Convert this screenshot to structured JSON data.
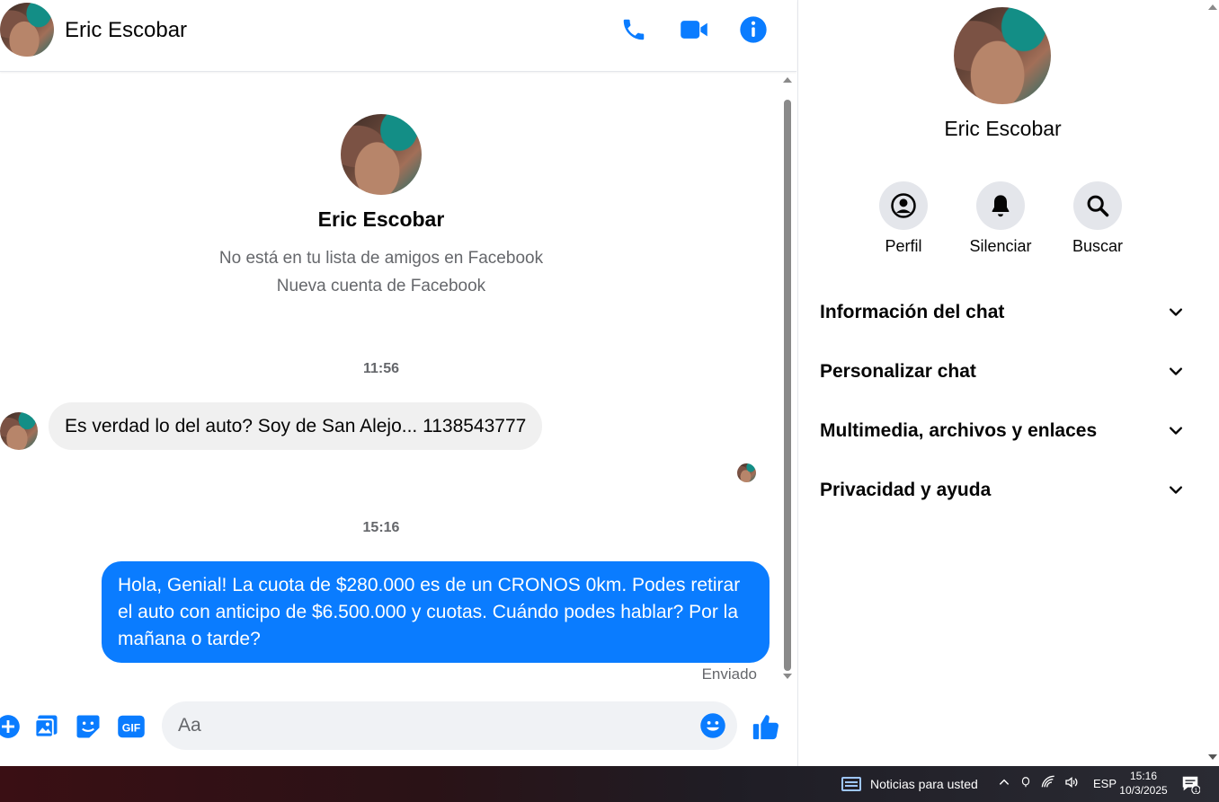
{
  "chat_header": {
    "name": "Eric Escobar",
    "icons": [
      "phone-icon",
      "video-camera-icon",
      "info-icon"
    ]
  },
  "conversation": {
    "profile": {
      "name": "Eric Escobar",
      "line1": "No está en tu lista de amigos en Facebook",
      "line2": "Nueva cuenta de Facebook"
    },
    "messages": [
      {
        "time": "11:56",
        "direction": "incoming",
        "text": "Es verdad lo del auto? Soy de  San Alejo... 1138543777"
      },
      {
        "time": "15:16",
        "direction": "outgoing",
        "text": "Hola, Genial! La cuota de $280.000 es de un CRONOS 0km. Podes retirar el auto con anticipo de $6.500.000 y cuotas. Cuándo podes hablar? Por la mañana o tarde?",
        "status": "Enviado"
      }
    ]
  },
  "composer": {
    "placeholder": "Aa",
    "icons": [
      "plus-icon",
      "image-icon",
      "sticker-icon",
      "gif-icon",
      "emoji-icon",
      "thumbs-up-icon"
    ]
  },
  "info_panel": {
    "name": "Eric Escobar",
    "actions": [
      {
        "label": "Perfil",
        "icon": "profile-icon"
      },
      {
        "label": "Silenciar",
        "icon": "bell-icon"
      },
      {
        "label": "Buscar",
        "icon": "search-icon"
      }
    ],
    "sections": [
      "Información del chat",
      "Personalizar chat",
      "Multimedia, archivos y enlaces",
      "Privacidad y ayuda"
    ]
  },
  "taskbar": {
    "news": "Noticias para usted",
    "language": "ESP",
    "time": "15:16",
    "date": "10/3/2025",
    "notifications": "1"
  },
  "colors": {
    "accent": "#0a7cff",
    "incoming_bubble": "#f0f0f0",
    "secondary_text": "#65676b"
  }
}
